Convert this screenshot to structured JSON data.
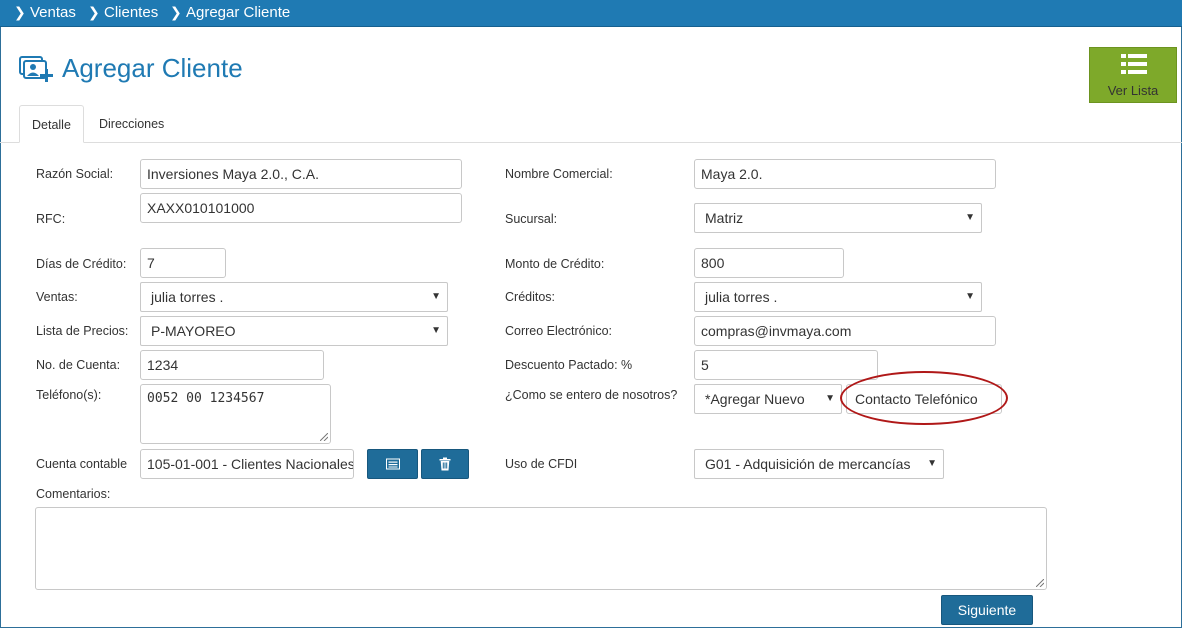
{
  "breadcrumb": [
    "Ventas",
    "Clientes",
    "Agregar Cliente"
  ],
  "page_title": "Agregar Cliente",
  "ver_lista_label": "Ver Lista",
  "tabs": [
    {
      "label": "Detalle",
      "active": true
    },
    {
      "label": "Direcciones",
      "active": false
    }
  ],
  "form": {
    "razon_social": {
      "label": "Razón Social:",
      "value": "Inversiones Maya 2.0., C.A."
    },
    "nombre_comercial": {
      "label": "Nombre Comercial:",
      "value": "Maya 2.0."
    },
    "rfc": {
      "label": "RFC:",
      "value": "XAXX010101000"
    },
    "sucursal": {
      "label": "Sucursal:",
      "value": "Matriz"
    },
    "dias_credito": {
      "label": "Días de Crédito:",
      "value": "7"
    },
    "monto_credito": {
      "label": "Monto de Crédito:",
      "value": "800"
    },
    "ventas": {
      "label": "Ventas:",
      "value": "julia torres ."
    },
    "creditos": {
      "label": "Créditos:",
      "value": "julia torres ."
    },
    "lista_precios": {
      "label": "Lista de Precios:",
      "value": "P-MAYOREO"
    },
    "correo": {
      "label": "Correo Electrónico:",
      "value": "compras@invmaya.com"
    },
    "no_cuenta": {
      "label": "No. de Cuenta:",
      "value": "1234"
    },
    "descuento": {
      "label": "Descuento Pactado: %",
      "value": "5"
    },
    "telefono": {
      "label": "Teléfono(s):",
      "value": "0052 00 1234567"
    },
    "como_se_entero": {
      "label": "¿Como se entero de nosotros?",
      "value": "*Agregar Nuevo",
      "new_value": "Contacto Telefónico"
    },
    "cuenta_contable": {
      "label": "Cuenta contable",
      "value": "105-01-001 - Clientes Nacionales"
    },
    "uso_cfdi": {
      "label": "Uso de CFDI",
      "value": "G01 - Adquisición de mercancías"
    },
    "comentarios": {
      "label": "Comentarios:",
      "value": ""
    }
  },
  "siguiente_label": "Siguiente",
  "colors": {
    "topbar": "#1f7ab3",
    "accent_green": "#7ea92a",
    "button_blue": "#1f6c99",
    "highlight_red": "#b01818"
  }
}
